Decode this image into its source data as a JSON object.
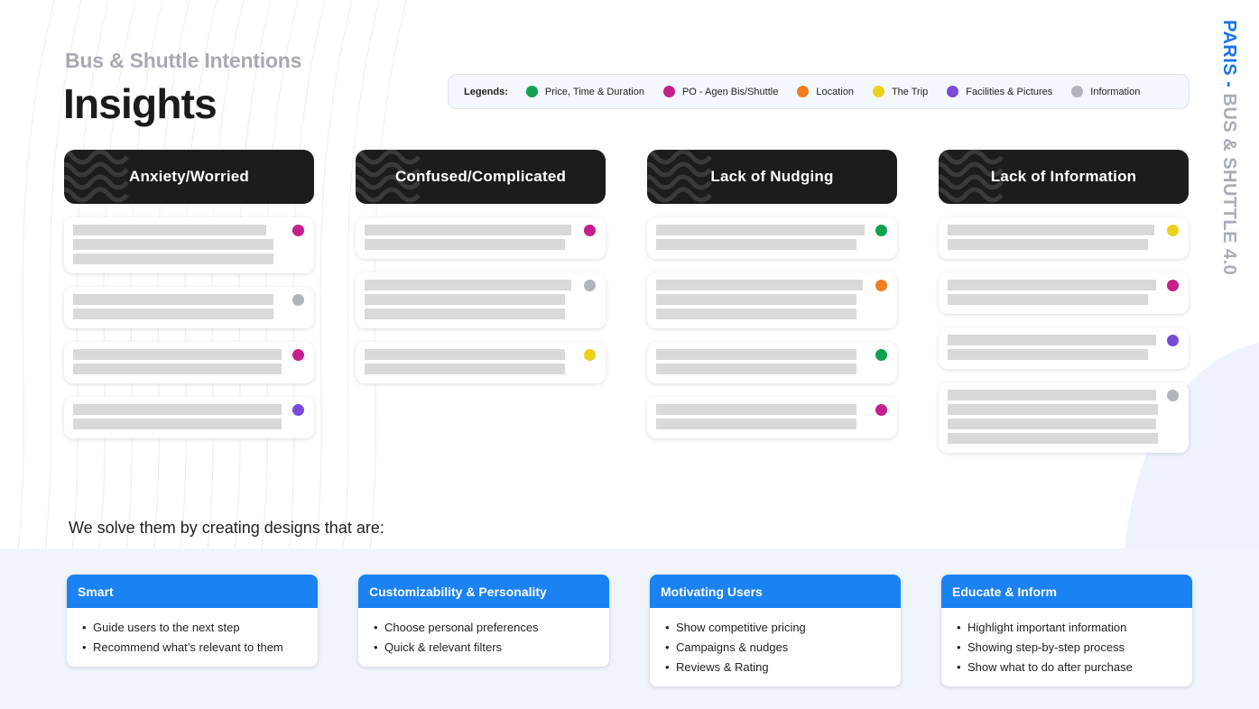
{
  "header": {
    "subtitle": "Bus & Shuttle Intentions",
    "title": "Insights",
    "vertical_title_part1": "PARIS - ",
    "vertical_title_part2": "BUS & SHUTTLE 4.0"
  },
  "legend": {
    "label": "Legends:",
    "items": [
      {
        "label": "Price, Time & Duration",
        "color": "#12a150"
      },
      {
        "label": "PO - Agen Bis/Shuttle",
        "color": "#c41f8b"
      },
      {
        "label": "Location",
        "color": "#f07f22"
      },
      {
        "label": "The Trip",
        "color": "#ead21a"
      },
      {
        "label": "Facilities & Pictures",
        "color": "#7a4bd8"
      },
      {
        "label": "Information",
        "color": "#b2b4bc"
      }
    ]
  },
  "columns": [
    {
      "title": "Anxiety/Worried",
      "cards": [
        {
          "category": "PO - Agen Bis/Shuttle",
          "lines": 3
        },
        {
          "category": "Information",
          "lines": 2
        },
        {
          "category": "PO - Agen Bis/Shuttle",
          "lines": 2
        },
        {
          "category": "Facilities & Pictures",
          "lines": 2
        }
      ]
    },
    {
      "title": "Confused/Complicated",
      "cards": [
        {
          "category": "PO - Agen Bis/Shuttle",
          "lines": 2
        },
        {
          "category": "Information",
          "lines": 3
        },
        {
          "category": "The Trip",
          "lines": 2
        }
      ]
    },
    {
      "title": "Lack of Nudging",
      "cards": [
        {
          "category": "Price, Time & Duration",
          "lines": 2
        },
        {
          "category": "Location",
          "lines": 3
        },
        {
          "category": "Price, Time & Duration",
          "lines": 2
        },
        {
          "category": "PO - Agen Bis/Shuttle",
          "lines": 2
        }
      ]
    },
    {
      "title": "Lack of Information",
      "cards": [
        {
          "category": "The Trip",
          "lines": 2
        },
        {
          "category": "PO - Agen Bis/Shuttle",
          "lines": 2
        },
        {
          "category": "Facilities & Pictures",
          "lines": 2
        },
        {
          "category": "Information",
          "lines": 4
        }
      ]
    }
  ],
  "solutions": {
    "intro": "We solve them by creating designs that are:",
    "cards": [
      {
        "title": "Smart",
        "points": [
          "Guide users to the next step",
          "Recommend what’s relevant to them"
        ]
      },
      {
        "title": "Customizability & Personality",
        "points": [
          "Choose personal preferences",
          "Quick & relevant filters"
        ]
      },
      {
        "title": "Motivating Users",
        "points": [
          "Show competitive pricing",
          "Campaigns & nudges",
          "Reviews & Rating"
        ]
      },
      {
        "title": "Educate & Inform",
        "points": [
          "Highlight important information",
          "Showing step-by-step process",
          "Show what to do after purchase"
        ]
      }
    ]
  }
}
